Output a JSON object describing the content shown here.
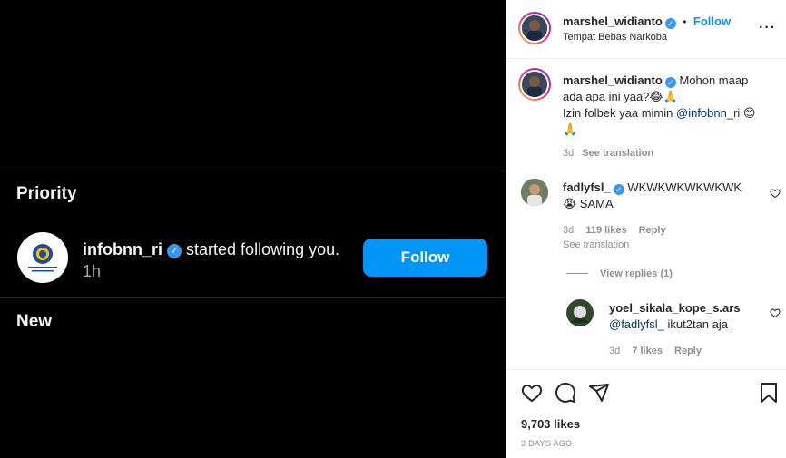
{
  "notifications": {
    "priority_heading": "Priority",
    "new_heading": "New",
    "item": {
      "username": "infobnn_ri",
      "verified": true,
      "action_text": "started following you.",
      "time": "1h",
      "follow_label": "Follow"
    }
  },
  "post": {
    "author": "marshel_widianto",
    "verified": true,
    "dot": "•",
    "follow_label": "Follow",
    "location": "Tempat Bebas Narkoba",
    "more_icon": "ellipsis-icon",
    "caption": {
      "username": "marshel_widianto",
      "line1": "Mohon maap ada apa ini yaa?😂🙏",
      "line2_prefix": "Izin folbek yaa mimin ",
      "mention": "@infobnn_ri",
      "line2_suffix": " 😊🙏",
      "time": "3d",
      "see_translation": "See translation"
    },
    "comments": [
      {
        "username": "fadlyfsl_",
        "verified": true,
        "text": "WKWKWKWKWKWK 😭 SAMA",
        "time": "3d",
        "likes": "119 likes",
        "reply": "Reply",
        "see_translation": "See translation",
        "view_replies": "View replies (1)"
      },
      {
        "username": "yoel_sikala_kope_s.ars",
        "mention": "@fadlyfsl_",
        "text": " ikut2tan aja",
        "time": "3d",
        "likes": "7 likes",
        "reply": "Reply"
      }
    ],
    "likes_count": "9,703 likes",
    "date": "3 DAYS AGO"
  }
}
